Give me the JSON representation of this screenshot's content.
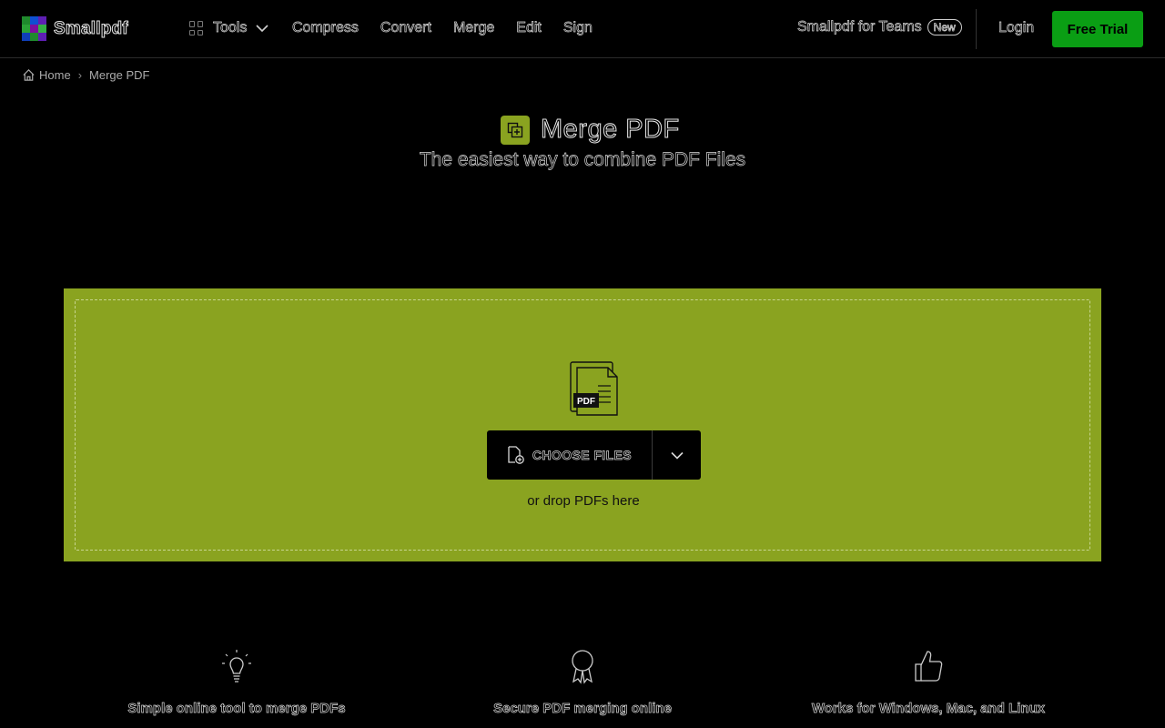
{
  "header": {
    "brand": "Smallpdf",
    "logo_colors": [
      "#1f8a2d",
      "#0f4fd1",
      "#5e1fb3",
      "#2aa336",
      "#7d0f9d",
      "#35b045",
      "#0f3fb8",
      "#1f8a2d",
      "#5e1fb3"
    ],
    "tools_label": "Tools",
    "nav": [
      "Compress",
      "Convert",
      "Merge",
      "Edit",
      "Sign"
    ],
    "teams_label": "Smallpdf for Teams",
    "new_badge": "New",
    "login_label": "Login",
    "free_trial_label": "Free Trial",
    "accent_green": "#0a9e14"
  },
  "breadcrumb": {
    "home": "Home",
    "separator": "›",
    "current": "Merge PDF"
  },
  "hero": {
    "title": "Merge PDF",
    "subtitle": "The easiest way to combine PDF Files",
    "accent": "#8aa320"
  },
  "dropzone": {
    "pdf_badge": "PDF",
    "choose_label": "CHOOSE FILES",
    "drop_hint": "or drop PDFs here",
    "background": "#8aa320"
  },
  "features": [
    {
      "icon": "lightbulb-icon",
      "label": "Simple online tool to merge PDFs"
    },
    {
      "icon": "award-ribbon-icon",
      "label": "Secure PDF merging online"
    },
    {
      "icon": "thumbs-up-icon",
      "label": "Works for Windows, Mac, and Linux"
    }
  ]
}
